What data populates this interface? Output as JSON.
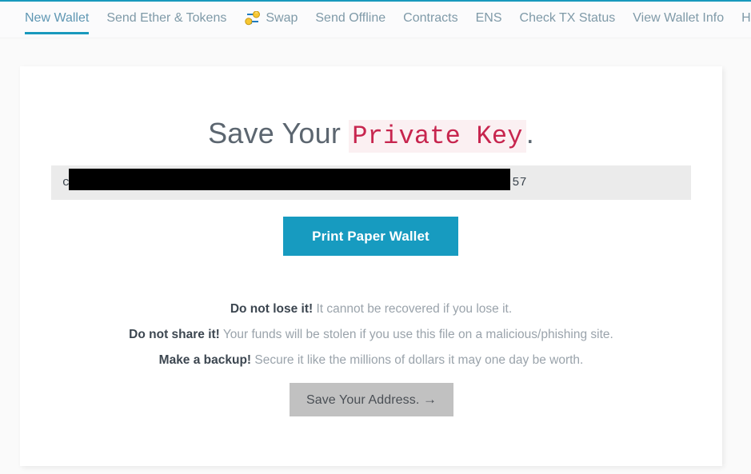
{
  "theme": {
    "accent": "#1899bd",
    "primary_button": "#179bc0",
    "disabled_button": "#c1c1c1",
    "code_color": "#c7254e",
    "code_background": "#fbf0f2",
    "page_background": "#fafafa",
    "card_background": "#ffffff",
    "field_background": "#ebebeb"
  },
  "nav": {
    "items": [
      {
        "label": "New Wallet",
        "active": true,
        "icon": null
      },
      {
        "label": "Send Ether & Tokens",
        "active": false,
        "icon": null
      },
      {
        "label": "Swap",
        "active": false,
        "icon": "swap-icon"
      },
      {
        "label": "Send Offline",
        "active": false,
        "icon": null
      },
      {
        "label": "Contracts",
        "active": false,
        "icon": null
      },
      {
        "label": "ENS",
        "active": false,
        "icon": null
      },
      {
        "label": "Check TX Status",
        "active": false,
        "icon": null
      },
      {
        "label": "View Wallet Info",
        "active": false,
        "icon": null
      },
      {
        "label": "Help",
        "active": false,
        "icon": null
      }
    ]
  },
  "main": {
    "title_prefix": "Save Your ",
    "title_code": "Private Key",
    "title_suffix": ".",
    "private_key": {
      "visible_prefix": "ca",
      "visible_suffix": "57",
      "redacted": true
    },
    "print_button": "Print Paper Wallet",
    "warnings": [
      {
        "strong": "Do not lose it!",
        "text": " It cannot be recovered if you lose it."
      },
      {
        "strong": "Do not share it!",
        "text": " Your funds will be stolen if you use this file on a malicious/phishing site."
      },
      {
        "strong": "Make a backup!",
        "text": " Secure it like the millions of dollars it may one day be worth."
      }
    ],
    "save_button": "Save Your Address.",
    "save_button_arrow": "→"
  }
}
